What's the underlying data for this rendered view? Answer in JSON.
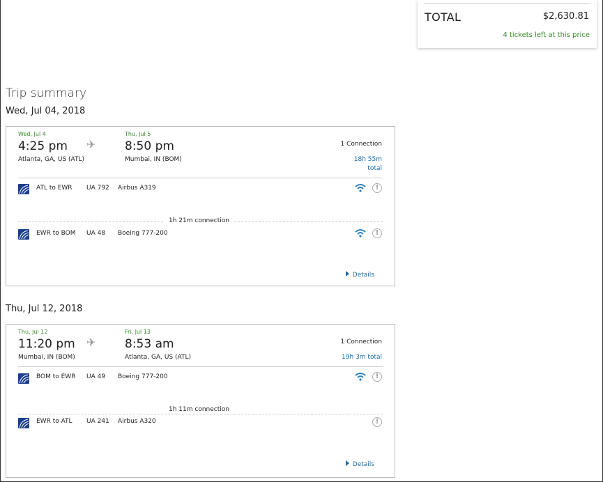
{
  "summary": {
    "total_label": "TOTAL",
    "total_amount": "$2,630.81",
    "tickets_left": "4 tickets left at this price"
  },
  "trip_summary_title": "Trip summary",
  "colors": {
    "accent_green": "#3a8a2a",
    "link_blue": "#1a6aa8",
    "wifi_blue": "#2c7fc0",
    "airline_logo": "#1b3f8f"
  },
  "trips": [
    {
      "date_heading": "Wed, Jul 04, 2018",
      "depart_date": "Wed, Jul 4",
      "depart_time": "4:25 pm",
      "depart_place": "Atlanta, GA, US (ATL)",
      "arrive_date": "Thu, Jul 5",
      "arrive_time": "8:50 pm",
      "arrive_place": "Mumbai, IN (BOM)",
      "connections": "1 Connection",
      "duration_line1": "18h 55m",
      "duration_line2": "total",
      "segments": [
        {
          "route": "ATL to EWR",
          "flight": "UA 792",
          "aircraft": "Airbus A319",
          "wifi_icon": "wifi-icon",
          "info_icon": "info-icon"
        },
        {
          "route": "EWR to BOM",
          "flight": "UA 48",
          "aircraft": "Boeing 777-200",
          "wifi_icon": "wifi-icon",
          "info_icon": "info-icon"
        }
      ],
      "connection_label": "1h 21m connection",
      "details_label": "Details"
    },
    {
      "date_heading": "Thu, Jul 12, 2018",
      "depart_date": "Thu, Jul 12",
      "depart_time": "11:20 pm",
      "depart_place": "Mumbai, IN (BOM)",
      "arrive_date": "Fri, Jul 13",
      "arrive_time": "8:53 am",
      "arrive_place": "Atlanta, GA, US (ATL)",
      "connections": "1 Connection",
      "duration_line1": "19h 3m total",
      "segments": [
        {
          "route": "BOM to EWR",
          "flight": "UA 49",
          "aircraft": "Boeing 777-200",
          "wifi_icon": "wifi-icon",
          "info_icon": "info-icon"
        },
        {
          "route": "EWR to ATL",
          "flight": "UA 241",
          "aircraft": "Airbus A320",
          "info_icon": "info-icon"
        }
      ],
      "connection_label": "1h 11m connection",
      "details_label": "Details"
    }
  ]
}
